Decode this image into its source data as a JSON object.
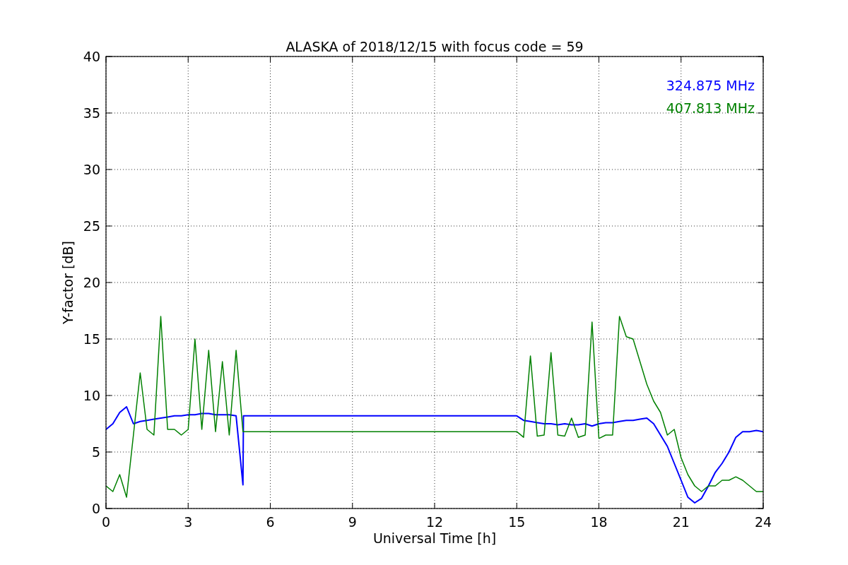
{
  "chart_data": {
    "type": "line",
    "title": "ALASKA of 2018/12/15 with focus code = 59",
    "xlabel": "Universal Time [h]",
    "ylabel": "Y-factor [dB]",
    "grid": true,
    "x": [
      0,
      0.25,
      0.5,
      0.75,
      1,
      1.25,
      1.5,
      1.75,
      2,
      2.25,
      2.5,
      2.75,
      3,
      3.25,
      3.5,
      3.75,
      4,
      4.25,
      4.5,
      4.75,
      5,
      5.02,
      15,
      15.25,
      15.5,
      15.75,
      16,
      16.25,
      16.5,
      16.75,
      17,
      17.25,
      17.5,
      17.75,
      18,
      18.25,
      18.5,
      18.75,
      19,
      19.25,
      19.5,
      19.75,
      20,
      20.25,
      20.5,
      20.75,
      21,
      21.25,
      21.5,
      21.75,
      22,
      22.25,
      22.5,
      22.75,
      23,
      23.25,
      23.5,
      23.75,
      24
    ],
    "series": [
      {
        "name": "324.875 MHz",
        "color": "#0000ff",
        "values": [
          7.0,
          7.5,
          8.5,
          9.0,
          7.5,
          7.7,
          7.8,
          7.9,
          8.0,
          8.1,
          8.2,
          8.2,
          8.3,
          8.3,
          8.4,
          8.4,
          8.3,
          8.3,
          8.3,
          8.2,
          2.1,
          8.2,
          8.2,
          7.8,
          7.7,
          7.6,
          7.5,
          7.5,
          7.4,
          7.5,
          7.4,
          7.4,
          7.5,
          7.3,
          7.5,
          7.6,
          7.6,
          7.7,
          7.8,
          7.8,
          7.9,
          8.0,
          7.5,
          6.5,
          5.5,
          4.0,
          2.5,
          1.0,
          0.5,
          0.9,
          2.0,
          3.2,
          4.0,
          5.0,
          6.3,
          6.8,
          6.8,
          6.9,
          6.8
        ]
      },
      {
        "name": "407.813 MHz",
        "color": "#008000",
        "values": [
          2.0,
          1.5,
          3.0,
          1.0,
          6.5,
          12,
          7,
          6.5,
          17,
          7,
          7,
          6.5,
          7,
          15,
          7,
          14,
          6.8,
          13,
          6.5,
          14,
          6.8,
          6.8,
          6.8,
          6.3,
          13.5,
          6.4,
          6.5,
          13.8,
          6.5,
          6.4,
          8,
          6.3,
          6.5,
          16.5,
          6.2,
          6.5,
          6.5,
          17,
          15.2,
          15,
          13,
          11,
          9.5,
          8.5,
          6.5,
          7,
          4.5,
          3,
          2,
          1.5,
          2,
          2,
          2.5,
          2.5,
          2.8,
          2.5,
          2,
          1.5,
          1.5
        ]
      }
    ],
    "xlim": [
      0,
      24
    ],
    "ylim": [
      0,
      40
    ],
    "xticks": [
      0,
      3,
      6,
      9,
      12,
      15,
      18,
      21,
      24
    ],
    "yticks": [
      0,
      5,
      10,
      15,
      20,
      25,
      30,
      35,
      40
    ]
  }
}
